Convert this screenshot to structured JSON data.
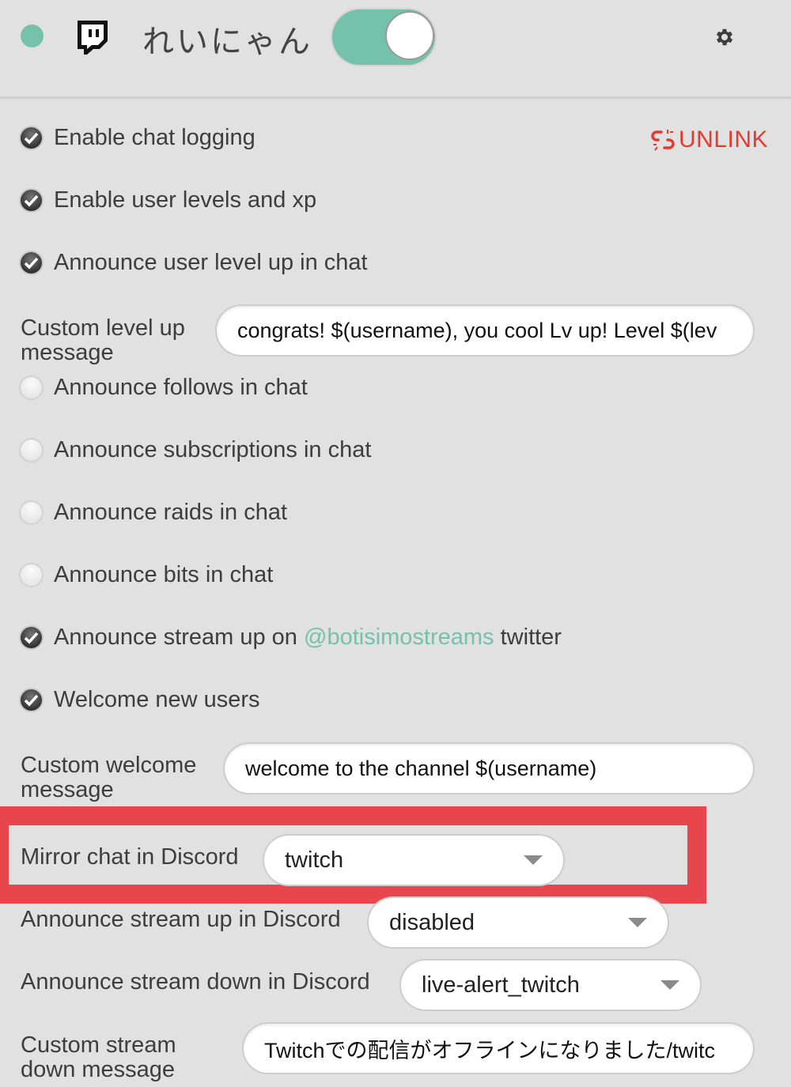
{
  "header": {
    "status": "online",
    "platform_icon": "twitch-icon",
    "channel_name": "れいにゃん",
    "toggle_on": true,
    "settings_icon": "gear-icon"
  },
  "unlink": {
    "icon": "broken-link-icon",
    "label": "UNLINK"
  },
  "options": [
    {
      "label": "Enable chat logging",
      "checked": true
    },
    {
      "label": "Enable user levels and xp",
      "checked": true
    },
    {
      "label": "Announce user level up in chat",
      "checked": true
    }
  ],
  "level_up_message": {
    "label_line1": "Custom level up",
    "label_line2": "message",
    "value": "congrats! $(username), you cool Lv up! Level $(lev"
  },
  "options2": [
    {
      "label": "Announce follows in chat",
      "checked": false
    },
    {
      "label": "Announce subscriptions in chat",
      "checked": false
    },
    {
      "label": "Announce raids in chat",
      "checked": false
    },
    {
      "label": "Announce bits in chat",
      "checked": false
    }
  ],
  "twitter_option": {
    "prefix": "Announce stream up on",
    "handle": "@botisimostreams",
    "suffix": "twitter",
    "checked": true
  },
  "welcome_option": {
    "label": "Welcome new users",
    "checked": true
  },
  "welcome_message": {
    "label_line1": "Custom welcome",
    "label_line2": "message",
    "value": "welcome to the channel $(username)"
  },
  "mirror_chat": {
    "label": "Mirror chat in Discord",
    "value": "twitch"
  },
  "stream_up_discord": {
    "label": "Announce stream up in Discord",
    "value": "disabled"
  },
  "stream_down_discord": {
    "label": "Announce stream down in Discord",
    "value": "live-alert_twitch"
  },
  "stream_down_message": {
    "label_line1": "Custom stream",
    "label_line2": "down message",
    "value": "Twitchでの配信がオフラインになりました/twitc"
  },
  "colors": {
    "accent": "#75c1a9",
    "danger": "#e53a2e",
    "highlight": "#e8464d"
  }
}
